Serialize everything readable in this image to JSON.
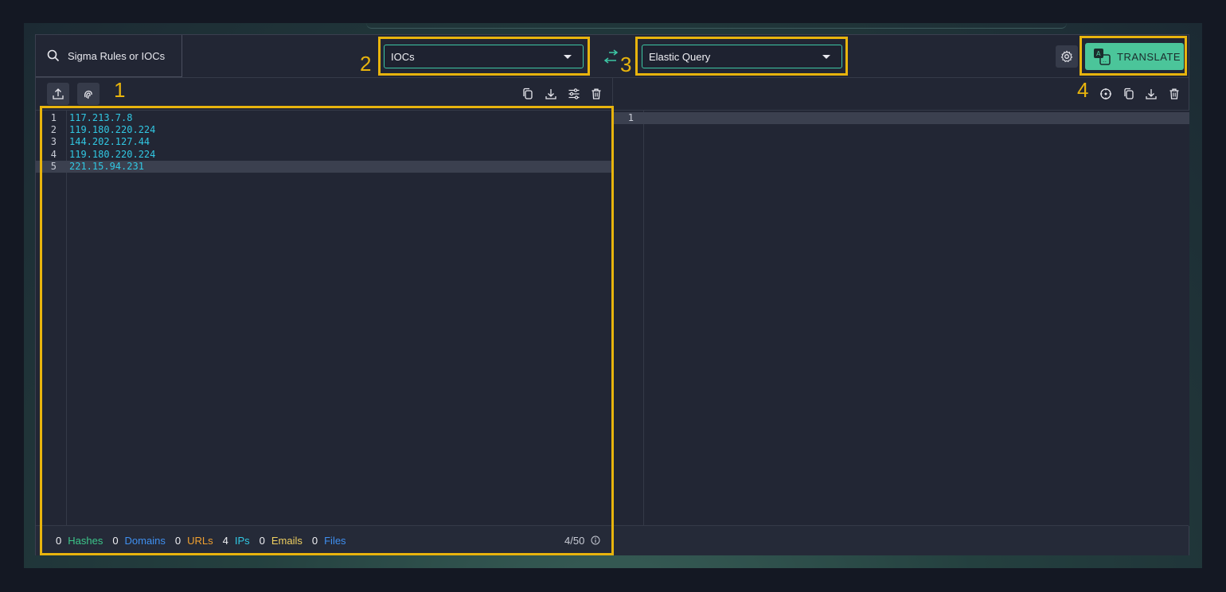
{
  "search": {
    "label": "Sigma Rules or IOCs",
    "icon": "search-icon"
  },
  "source_dropdown": {
    "value": "IOCs"
  },
  "target_dropdown": {
    "value": "Elastic Query"
  },
  "translate_button": {
    "label": "TRANSLATE",
    "color": "#4bc59a"
  },
  "annotations": [
    "1",
    "2",
    "3",
    "4"
  ],
  "editor_left": {
    "lines": [
      {
        "n": "1",
        "text": "117.213.7.8"
      },
      {
        "n": "2",
        "text": "119.180.220.224"
      },
      {
        "n": "3",
        "text": "144.202.127.44"
      },
      {
        "n": "4",
        "text": "119.180.220.224"
      },
      {
        "n": "5",
        "text": "221.15.94.231"
      }
    ],
    "active_line": 5
  },
  "editor_right": {
    "lines": [
      {
        "n": "1",
        "text": ""
      }
    ]
  },
  "footer": {
    "stats": [
      {
        "count": "0",
        "label": "Hashes",
        "color": "#3cc68a"
      },
      {
        "count": "0",
        "label": "Domains",
        "color": "#3f8ff0"
      },
      {
        "count": "0",
        "label": "URLs",
        "color": "#f0a030"
      },
      {
        "count": "4",
        "label": "IPs",
        "color": "#31c8e3"
      },
      {
        "count": "0",
        "label": "Emails",
        "color": "#f0d060"
      },
      {
        "count": "0",
        "label": "Files",
        "color": "#3f8ff0"
      }
    ],
    "limit": "4/50"
  },
  "colors": {
    "highlight": "#e8b40d",
    "accent": "#3cc6a4",
    "ip_text": "#31c8e3"
  }
}
